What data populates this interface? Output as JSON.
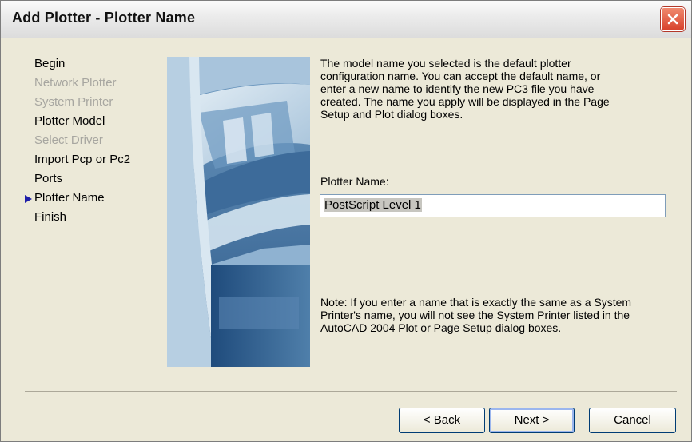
{
  "window": {
    "title": "Add Plotter - Plotter Name"
  },
  "steps": [
    {
      "label": "Begin",
      "state": "enabled"
    },
    {
      "label": "Network Plotter",
      "state": "disabled"
    },
    {
      "label": "System Printer",
      "state": "disabled"
    },
    {
      "label": "Plotter Model",
      "state": "enabled"
    },
    {
      "label": "Select Driver",
      "state": "disabled"
    },
    {
      "label": "Import Pcp or Pc2",
      "state": "enabled"
    },
    {
      "label": "Ports",
      "state": "enabled"
    },
    {
      "label": "Plotter Name",
      "state": "current"
    },
    {
      "label": "Finish",
      "state": "enabled"
    }
  ],
  "main": {
    "description_lines": [
      "The model name you selected is the default plotter",
      "configuration name. You can accept the default name, or",
      "enter a new name to identify the new PC3 file you have",
      "created. The name you apply will be displayed in the Page",
      "Setup and Plot dialog boxes."
    ],
    "field_label": "Plotter Name:",
    "field_value": "PostScript Level 1",
    "note_lines": [
      "Note: If you enter a name that is exactly the same as a System",
      "Printer's name, you will not see the System Printer listed in the",
      "AutoCAD 2004 Plot or Page Setup dialog boxes."
    ]
  },
  "buttons": {
    "back": "< Back",
    "next": "Next >",
    "cancel": "Cancel"
  },
  "colors": {
    "disabled_text": "#a7a6a0",
    "arrow": "#1e1ea8",
    "close_button": "#d7402a"
  }
}
